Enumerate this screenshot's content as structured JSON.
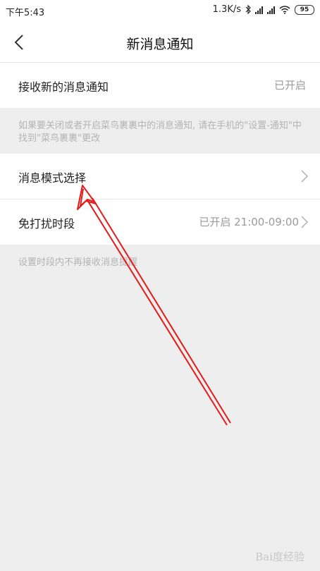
{
  "status": {
    "time": "下午5:43",
    "speed": "1.3K/s",
    "battery": "95"
  },
  "header": {
    "title": "新消息通知"
  },
  "settings": {
    "receive": {
      "label": "接收新的消息通知",
      "value": "已开启"
    },
    "note1": "如果要关闭或者开启菜鸟裹裹中的消息通知, 请在手机的\"设置-通知\"中找到\"菜鸟裹裹\"更改",
    "mode": {
      "label": "消息模式选择"
    },
    "dnd": {
      "label": "免打扰时段",
      "value": "已开启 21:00-09:00"
    },
    "note2": "设置时段内不再接收消息提醒"
  },
  "watermark": "Bai度经验",
  "colors": {
    "annotation_arrow": "#e31b1b",
    "page_background": "#eeeeee"
  }
}
